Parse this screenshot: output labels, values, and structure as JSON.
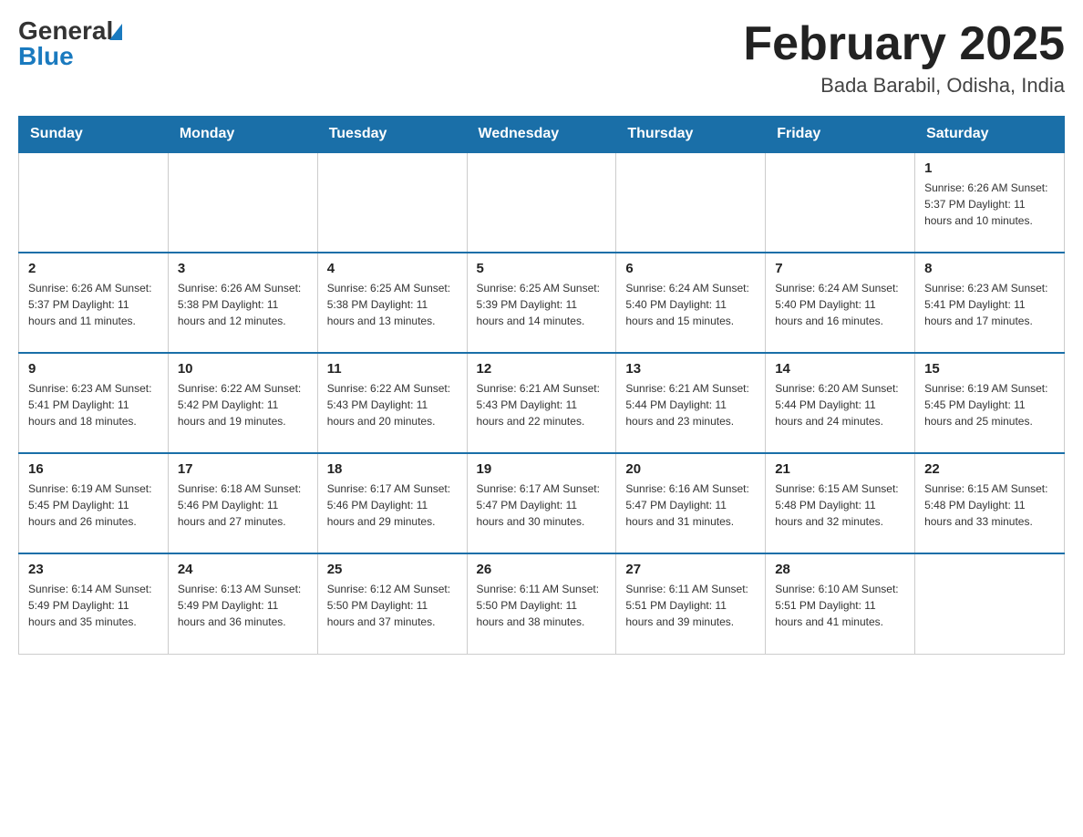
{
  "header": {
    "logo_general": "General",
    "logo_blue": "Blue",
    "month_title": "February 2025",
    "location": "Bada Barabil, Odisha, India"
  },
  "weekdays": [
    "Sunday",
    "Monday",
    "Tuesday",
    "Wednesday",
    "Thursday",
    "Friday",
    "Saturday"
  ],
  "weeks": [
    [
      {
        "day": "",
        "info": ""
      },
      {
        "day": "",
        "info": ""
      },
      {
        "day": "",
        "info": ""
      },
      {
        "day": "",
        "info": ""
      },
      {
        "day": "",
        "info": ""
      },
      {
        "day": "",
        "info": ""
      },
      {
        "day": "1",
        "info": "Sunrise: 6:26 AM\nSunset: 5:37 PM\nDaylight: 11 hours and 10 minutes."
      }
    ],
    [
      {
        "day": "2",
        "info": "Sunrise: 6:26 AM\nSunset: 5:37 PM\nDaylight: 11 hours and 11 minutes."
      },
      {
        "day": "3",
        "info": "Sunrise: 6:26 AM\nSunset: 5:38 PM\nDaylight: 11 hours and 12 minutes."
      },
      {
        "day": "4",
        "info": "Sunrise: 6:25 AM\nSunset: 5:38 PM\nDaylight: 11 hours and 13 minutes."
      },
      {
        "day": "5",
        "info": "Sunrise: 6:25 AM\nSunset: 5:39 PM\nDaylight: 11 hours and 14 minutes."
      },
      {
        "day": "6",
        "info": "Sunrise: 6:24 AM\nSunset: 5:40 PM\nDaylight: 11 hours and 15 minutes."
      },
      {
        "day": "7",
        "info": "Sunrise: 6:24 AM\nSunset: 5:40 PM\nDaylight: 11 hours and 16 minutes."
      },
      {
        "day": "8",
        "info": "Sunrise: 6:23 AM\nSunset: 5:41 PM\nDaylight: 11 hours and 17 minutes."
      }
    ],
    [
      {
        "day": "9",
        "info": "Sunrise: 6:23 AM\nSunset: 5:41 PM\nDaylight: 11 hours and 18 minutes."
      },
      {
        "day": "10",
        "info": "Sunrise: 6:22 AM\nSunset: 5:42 PM\nDaylight: 11 hours and 19 minutes."
      },
      {
        "day": "11",
        "info": "Sunrise: 6:22 AM\nSunset: 5:43 PM\nDaylight: 11 hours and 20 minutes."
      },
      {
        "day": "12",
        "info": "Sunrise: 6:21 AM\nSunset: 5:43 PM\nDaylight: 11 hours and 22 minutes."
      },
      {
        "day": "13",
        "info": "Sunrise: 6:21 AM\nSunset: 5:44 PM\nDaylight: 11 hours and 23 minutes."
      },
      {
        "day": "14",
        "info": "Sunrise: 6:20 AM\nSunset: 5:44 PM\nDaylight: 11 hours and 24 minutes."
      },
      {
        "day": "15",
        "info": "Sunrise: 6:19 AM\nSunset: 5:45 PM\nDaylight: 11 hours and 25 minutes."
      }
    ],
    [
      {
        "day": "16",
        "info": "Sunrise: 6:19 AM\nSunset: 5:45 PM\nDaylight: 11 hours and 26 minutes."
      },
      {
        "day": "17",
        "info": "Sunrise: 6:18 AM\nSunset: 5:46 PM\nDaylight: 11 hours and 27 minutes."
      },
      {
        "day": "18",
        "info": "Sunrise: 6:17 AM\nSunset: 5:46 PM\nDaylight: 11 hours and 29 minutes."
      },
      {
        "day": "19",
        "info": "Sunrise: 6:17 AM\nSunset: 5:47 PM\nDaylight: 11 hours and 30 minutes."
      },
      {
        "day": "20",
        "info": "Sunrise: 6:16 AM\nSunset: 5:47 PM\nDaylight: 11 hours and 31 minutes."
      },
      {
        "day": "21",
        "info": "Sunrise: 6:15 AM\nSunset: 5:48 PM\nDaylight: 11 hours and 32 minutes."
      },
      {
        "day": "22",
        "info": "Sunrise: 6:15 AM\nSunset: 5:48 PM\nDaylight: 11 hours and 33 minutes."
      }
    ],
    [
      {
        "day": "23",
        "info": "Sunrise: 6:14 AM\nSunset: 5:49 PM\nDaylight: 11 hours and 35 minutes."
      },
      {
        "day": "24",
        "info": "Sunrise: 6:13 AM\nSunset: 5:49 PM\nDaylight: 11 hours and 36 minutes."
      },
      {
        "day": "25",
        "info": "Sunrise: 6:12 AM\nSunset: 5:50 PM\nDaylight: 11 hours and 37 minutes."
      },
      {
        "day": "26",
        "info": "Sunrise: 6:11 AM\nSunset: 5:50 PM\nDaylight: 11 hours and 38 minutes."
      },
      {
        "day": "27",
        "info": "Sunrise: 6:11 AM\nSunset: 5:51 PM\nDaylight: 11 hours and 39 minutes."
      },
      {
        "day": "28",
        "info": "Sunrise: 6:10 AM\nSunset: 5:51 PM\nDaylight: 11 hours and 41 minutes."
      },
      {
        "day": "",
        "info": ""
      }
    ]
  ]
}
